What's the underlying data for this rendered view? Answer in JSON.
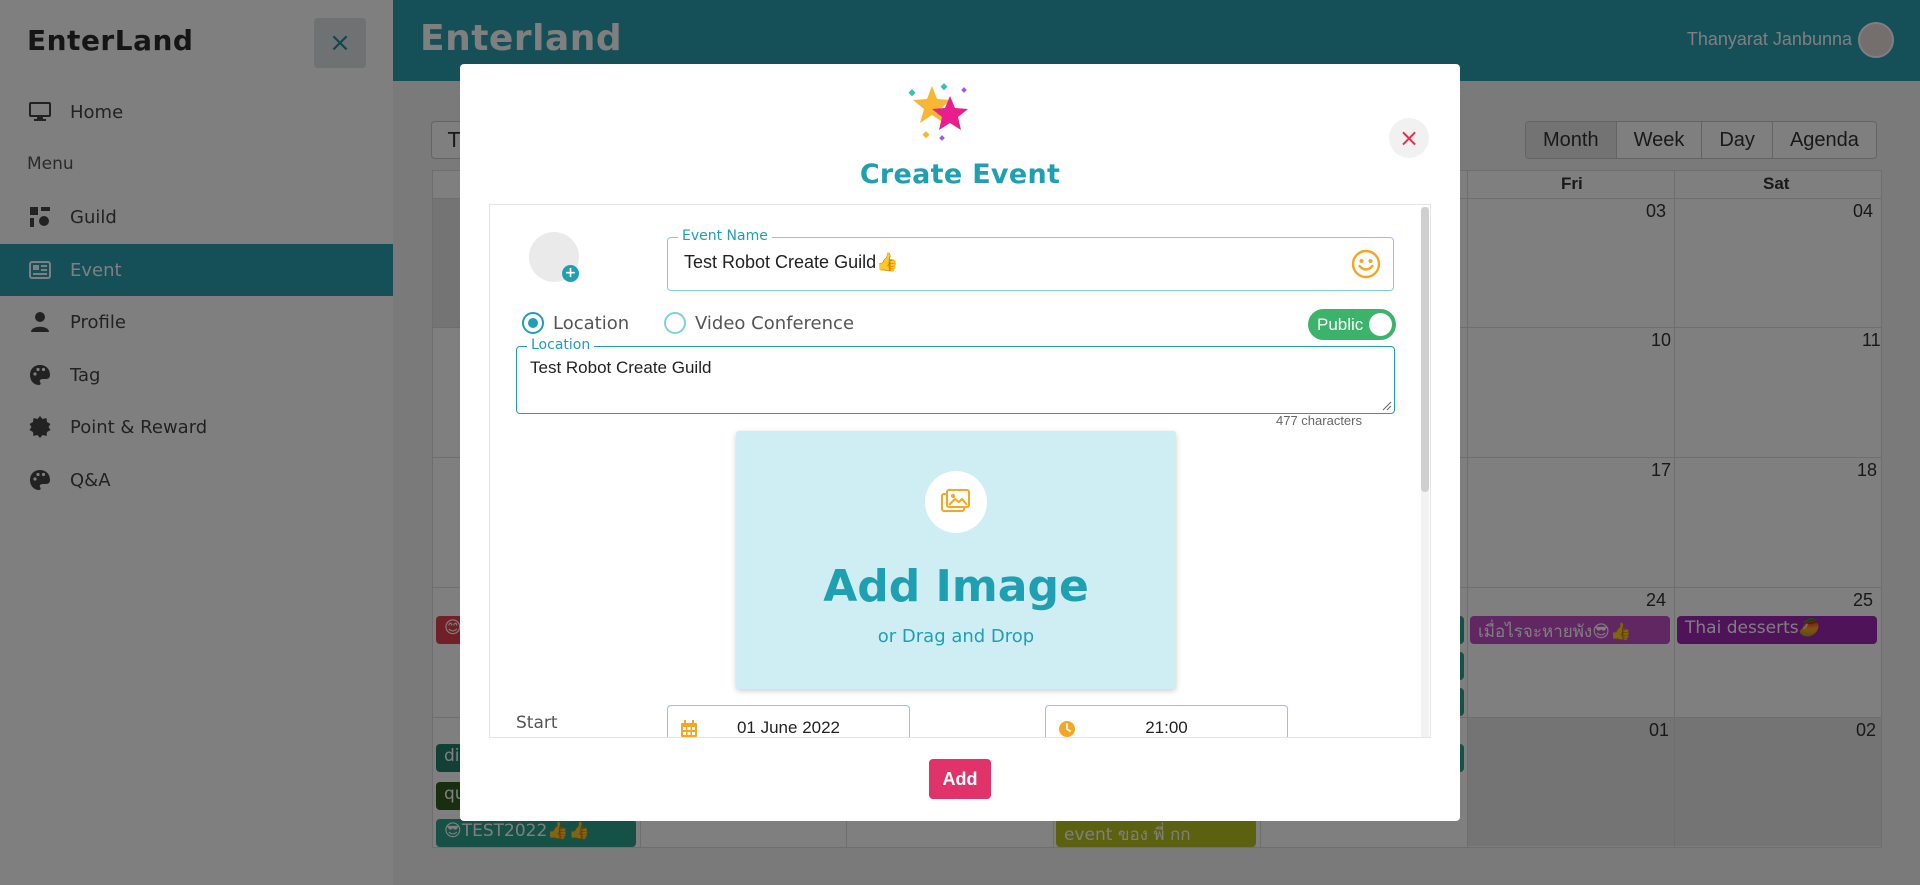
{
  "sidebar": {
    "logo": "EnterLand",
    "close_icon": "×",
    "section_label": "Menu",
    "items": [
      {
        "label": "Home",
        "icon": "desktop-icon"
      },
      {
        "label": "Guild",
        "icon": "guild-icon"
      },
      {
        "label": "Event",
        "icon": "newspaper-icon",
        "active": true
      },
      {
        "label": "Profile",
        "icon": "user-icon"
      },
      {
        "label": "Tag",
        "icon": "palette-icon"
      },
      {
        "label": "Point & Reward",
        "icon": "badge-icon"
      },
      {
        "label": "Q&A",
        "icon": "palette-icon"
      }
    ]
  },
  "topbar": {
    "title": "Enterland",
    "user_name": "Thanyarat Janbunna"
  },
  "calendar": {
    "nav_button": "T",
    "views": [
      "Month",
      "Week",
      "Day",
      "Agenda"
    ],
    "active_view": "Month",
    "day_headers": [
      "Fri",
      "Sat"
    ],
    "dates": [
      "03",
      "04",
      "10",
      "11",
      "17",
      "18",
      "24",
      "25",
      "01",
      "02"
    ],
    "events": [
      {
        "label": "เมื่อไรจะหายพัง😎👍",
        "color": "#c04fc4"
      },
      {
        "label": "Thai desserts🥭",
        "color": "#9c27b0"
      },
      {
        "label": "di",
        "color": "#22806e"
      },
      {
        "label": "qu",
        "color": "#2e5e1c"
      },
      {
        "label": "😎TEST2022👍👍",
        "color": "#2aa38d"
      },
      {
        "label": "event ของ พี่ กก",
        "color": "#b9c21f"
      },
      {
        "label": "😊",
        "color": "#e0434f"
      }
    ]
  },
  "modal": {
    "title": "Create Event",
    "close_icon": "×",
    "event_name": {
      "label": "Event Name",
      "value": "Test Robot Create Guild👍"
    },
    "location_type": {
      "options": [
        "Location",
        "Video Conference"
      ],
      "selected": "Location"
    },
    "visibility": {
      "label": "Public",
      "on": true
    },
    "location": {
      "label": "Location",
      "value": "Test Robot Create Guild",
      "counter": "477 characters"
    },
    "image_upload": {
      "title": "Add Image",
      "subtitle": "or Drag and Drop"
    },
    "start": {
      "label": "Start",
      "date": "01 June 2022",
      "time": "21:00"
    },
    "submit_label": "Add"
  },
  "colors": {
    "primary": "#2a9fb0",
    "accent": "#e0336a",
    "toggle_on": "#3bb36b",
    "close_red": "#e0304e"
  }
}
